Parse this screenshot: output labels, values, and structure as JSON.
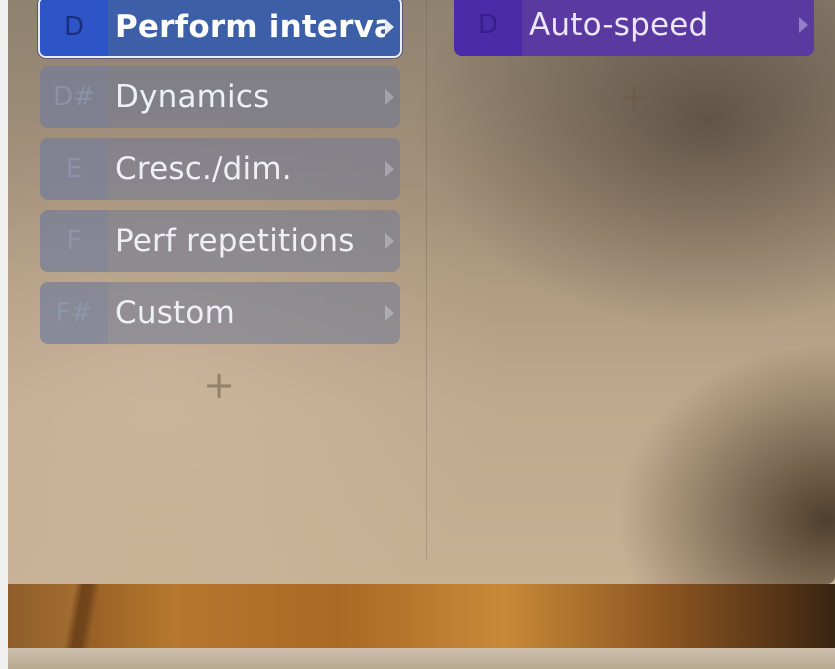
{
  "left_column": {
    "items": [
      {
        "key": "D",
        "label": "Perform interval",
        "state": "active"
      },
      {
        "key": "D#",
        "label": "Dynamics",
        "state": "normal"
      },
      {
        "key": "E",
        "label": "Cresc./dim.",
        "state": "normal"
      },
      {
        "key": "F",
        "label": "Perf repetitions",
        "state": "normal"
      },
      {
        "key": "F#",
        "label": "Custom",
        "state": "normal"
      }
    ],
    "add_label": "+"
  },
  "right_column": {
    "items": [
      {
        "key": "D",
        "label": "Auto-speed",
        "state": "purple"
      }
    ],
    "add_label": "+"
  },
  "colors": {
    "active_item": "#3c5fa8",
    "active_key": "#2e55c8",
    "purple_item": "#5a3aa0",
    "normal_item": "#6e7896"
  },
  "icons": {
    "submenu_arrow": "chevron-right-icon",
    "add": "plus-icon"
  }
}
